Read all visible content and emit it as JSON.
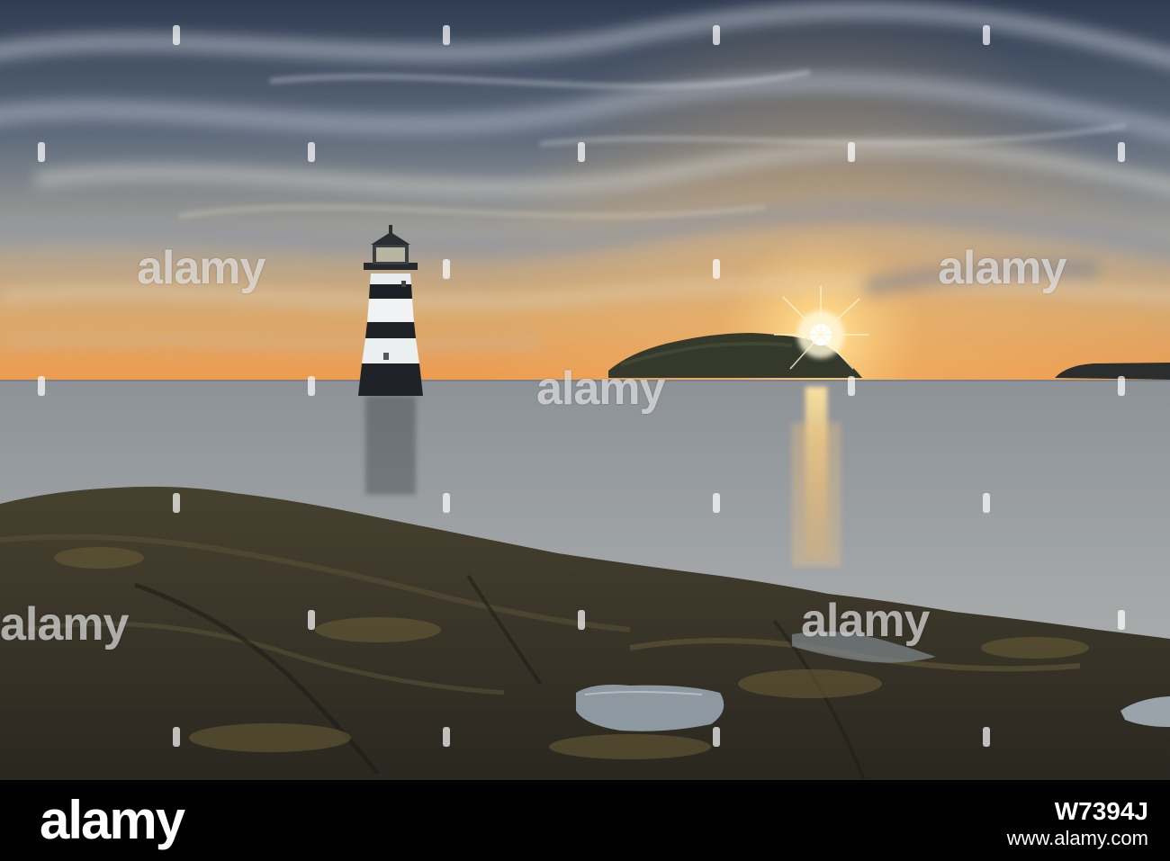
{
  "image": {
    "description_icon": "lighthouse-sunset-photo",
    "colors": {
      "sky_top": "#38475c",
      "sky_horizon": "#e8a660",
      "sun": "#fff2b0",
      "sea": "#9aa0a5",
      "rock": "#3a3528",
      "footer_bg": "#000000"
    }
  },
  "watermark": {
    "word": "alamy"
  },
  "footer": {
    "brand": "alamy",
    "image_id": "W7394J",
    "site": "www.alamy.com"
  }
}
